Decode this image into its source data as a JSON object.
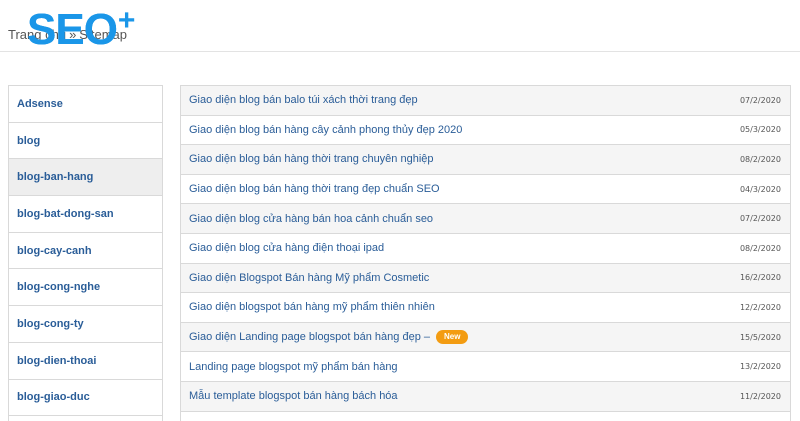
{
  "breadcrumb": {
    "home": "Trang chủ",
    "separator": "»",
    "current": "Sitemap"
  },
  "logo": {
    "text": "SEO",
    "plus": "+"
  },
  "colors": {
    "brand": "#1a96e8",
    "link": "#2a5d98",
    "badge": "#f39c12"
  },
  "sidebar": {
    "items": [
      {
        "label": "Adsense"
      },
      {
        "label": "blog"
      },
      {
        "label": "blog-ban-hang",
        "active": true
      },
      {
        "label": "blog-bat-dong-san"
      },
      {
        "label": "blog-cay-canh"
      },
      {
        "label": "blog-cong-nghe"
      },
      {
        "label": "blog-cong-ty"
      },
      {
        "label": "blog-dien-thoai"
      },
      {
        "label": "blog-giao-duc"
      }
    ]
  },
  "posts": [
    {
      "title": "Giao diện blog bán balo túi xách thời trang đẹp",
      "date": "07/2/2020"
    },
    {
      "title": "Giao diện blog bán hàng cây cảnh phong thủy đẹp 2020",
      "date": "05/3/2020"
    },
    {
      "title": "Giao diện blog bán hàng thời trang chuyên nghiệp",
      "date": "08/2/2020"
    },
    {
      "title": "Giao diện blog bán hàng thời trang đẹp chuẩn SEO",
      "date": "04/3/2020"
    },
    {
      "title": "Giao diện blog cửa hàng bán hoa cảnh chuẩn seo",
      "date": "07/2/2020"
    },
    {
      "title": "Giao diện blog cửa hàng điện thoại ipad",
      "date": "08/2/2020"
    },
    {
      "title": "Giao diện Blogspot Bán hàng Mỹ phẩm Cosmetic",
      "date": "16/2/2020"
    },
    {
      "title": "Giao diện blogspot bán hàng mỹ phẩm thiên nhiên",
      "date": "12/2/2020"
    },
    {
      "title": "Giao diện Landing page blogspot bán hàng đẹp –",
      "date": "15/5/2020",
      "badge": "New"
    },
    {
      "title": "Landing page blogspot mỹ phẩm bán hàng",
      "date": "13/2/2020"
    },
    {
      "title": "Mẫu template blogspot bán hàng bách hóa",
      "date": "11/2/2020"
    }
  ]
}
